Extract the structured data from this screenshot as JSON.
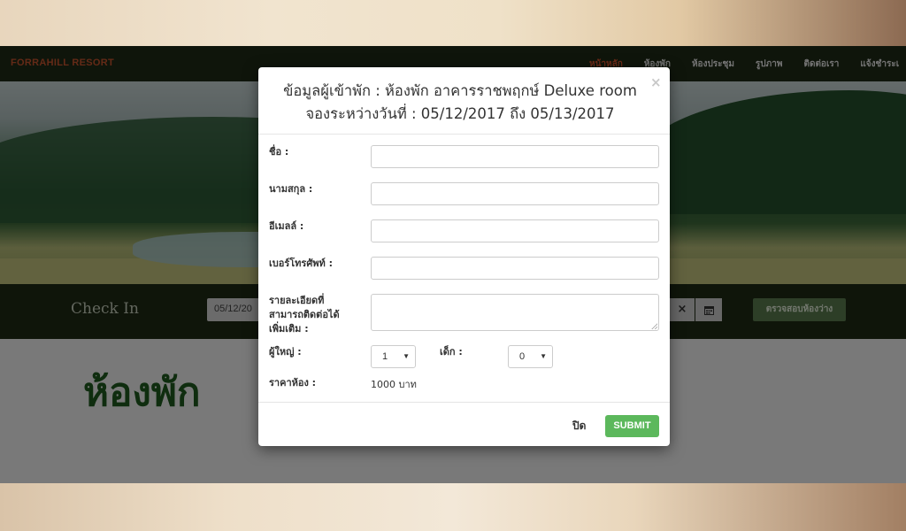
{
  "site": {
    "brand": "FORRAHILL RESORT",
    "nav": [
      "หน้าหลัก",
      "ห้องพัก",
      "ห้องประชุม",
      "รูปภาพ",
      "ติดต่อเรา",
      "แจ้งชำระเ"
    ],
    "active_nav_index": 0,
    "checkin_label": "Check In",
    "checkin_date": "05/12/20",
    "clear_icon": "×",
    "check_availability_label": "ตรวจสอบห้องว่าง",
    "section_title": "ห้องพัก"
  },
  "modal": {
    "title_line1": "ข้อมูลผู้เข้าพัก : ห้องพัก อาคารราชพฤกษ์ Deluxe room",
    "title_line2": "จองระหว่างวันที่ : 05/12/2017 ถึง 05/13/2017",
    "close_icon": "×",
    "fields": {
      "first_name": {
        "label": "ชื่อ :",
        "value": ""
      },
      "last_name": {
        "label": "นามสกุล :",
        "value": ""
      },
      "email": {
        "label": "อีเมลล์ :",
        "value": ""
      },
      "phone": {
        "label": "เบอร์โทรศัพท์ :",
        "value": ""
      },
      "details": {
        "label_line1": "รายละเอียดที่",
        "label_line2": "สามารถติดต่อได้",
        "label_line3": "เพิ่มเติม :",
        "value": ""
      },
      "adults": {
        "label": "ผู้ใหญ่ :",
        "value": "1"
      },
      "children": {
        "label": "เด็ก :",
        "value": "0"
      },
      "price": {
        "label": "ราคาห้อง :",
        "value": "1000 บาท"
      }
    },
    "close_button": "ปิด",
    "submit_button": "SUBMIT"
  },
  "colors": {
    "submit": "#5cb85c",
    "nav_active": "#d9542e",
    "brand": "#c9542e",
    "navbar_bg": "#1f2a16"
  }
}
